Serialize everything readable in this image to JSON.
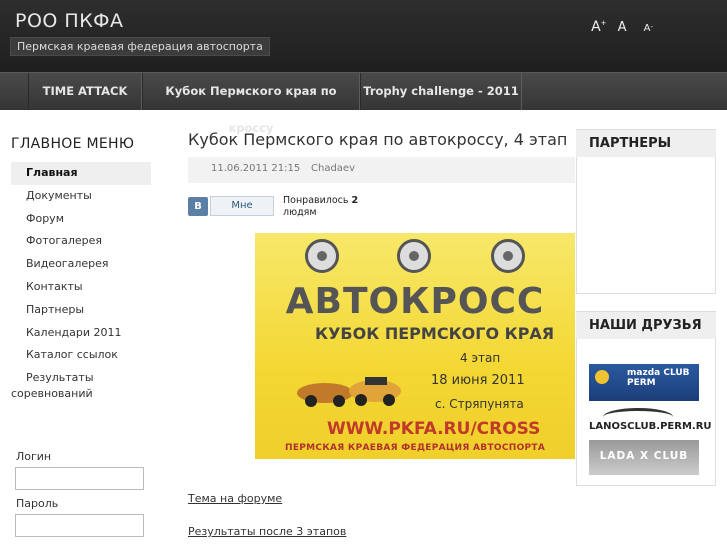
{
  "header": {
    "title": "РОО ПКФА",
    "subtitle": "Пермская краевая федерация автоспорта",
    "font_tools": {
      "increase": "A",
      "reset": "A",
      "decrease": "A",
      "increase_sup": "+",
      "decrease_sup": "-"
    }
  },
  "nav": {
    "items": [
      {
        "label": "TIME ATTACK"
      },
      {
        "label": "Кубок Пермского края по кроссу"
      },
      {
        "label": "Trophy challenge - 2011"
      }
    ]
  },
  "sidebar": {
    "title": "ГЛАВНОЕ МЕНЮ",
    "items": [
      {
        "label": "Главная",
        "active": true
      },
      {
        "label": "Документы"
      },
      {
        "label": "Форум"
      },
      {
        "label": "Фотогалерея"
      },
      {
        "label": "Видеогалерея"
      },
      {
        "label": "Контакты"
      },
      {
        "label": "Партнеры"
      },
      {
        "label": "Календари 2011"
      },
      {
        "label": "Каталог ссылок"
      },
      {
        "label": "Результаты",
        "label2": "соревнований"
      }
    ],
    "login": {
      "login_label": "Логин",
      "password_label": "Пароль"
    }
  },
  "article": {
    "title": "Кубок Пермского края по автокроссу, 4 этап",
    "date": "11.06.2011 21:15",
    "author": "Chadaev",
    "vk": {
      "icon": "В",
      "button": "Мне",
      "like_prefix": "Понравилось ",
      "like_count": "2",
      "like_suffix": "людям"
    },
    "banner": {
      "title": "АВТОКРОСС",
      "subtitle": "КУБОК ПЕРМСКОГО КРАЯ",
      "stage": "4 этап",
      "date": "18 июня 2011",
      "place": "с. Стряпунята",
      "url": "WWW.PKFA.RU/CROSS",
      "federation": "ПЕРМСКАЯ КРАЕВАЯ ФЕДЕРАЦИЯ АВТОСПОРТА"
    },
    "links": [
      {
        "label": "Тема на форуме"
      },
      {
        "label": "Результаты после 3 этапов"
      }
    ]
  },
  "right": {
    "partners_title": "ПАРТНЕРЫ",
    "friends_title": "НАШИ ДРУЗЬЯ",
    "friends": [
      {
        "label": "mazda CLUB PERM"
      },
      {
        "label": "LANOSCLUB.PERM.RU"
      },
      {
        "label": "LADA X CLUB"
      }
    ]
  }
}
